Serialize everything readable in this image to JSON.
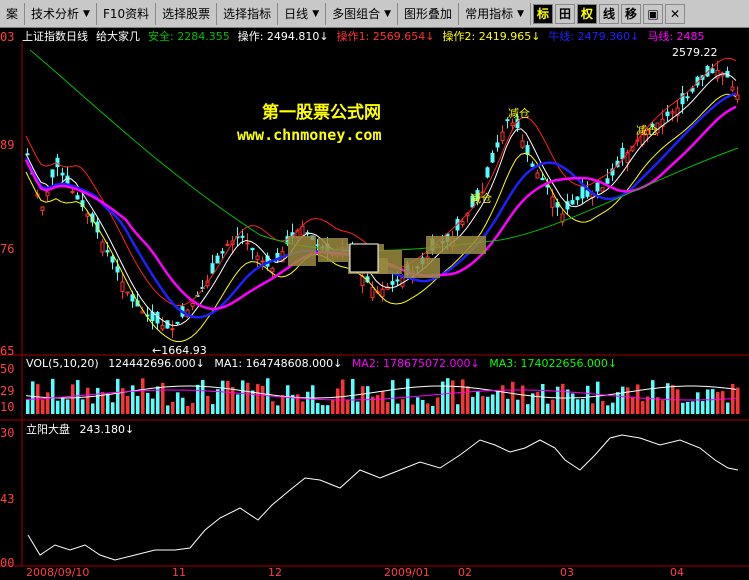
{
  "toolbar": {
    "items": [
      {
        "label": "案",
        "has_arrow": false
      },
      {
        "label": "技术分析",
        "has_arrow": true
      },
      {
        "label": "F10资料",
        "has_arrow": false
      },
      {
        "label": "选择股票",
        "has_arrow": false
      },
      {
        "label": "选择指标",
        "has_arrow": false
      },
      {
        "label": "日线",
        "has_arrow": true
      },
      {
        "label": "多图组合",
        "has_arrow": true
      },
      {
        "label": "图形叠加",
        "has_arrow": false
      },
      {
        "label": "常用指标",
        "has_arrow": true
      }
    ],
    "squares": [
      {
        "label": "标",
        "highlight": true
      },
      {
        "label": "田",
        "highlight": false
      },
      {
        "label": "权",
        "highlight": true
      },
      {
        "label": "线",
        "highlight": false
      },
      {
        "label": "移",
        "highlight": false
      },
      {
        "label": "▣",
        "highlight": false
      },
      {
        "label": "✕",
        "highlight": false
      }
    ]
  },
  "info": {
    "title": "上证指数日线",
    "indicator": "给大家几",
    "safe": "安全: 2284.355",
    "op": "操作: 2494.810↓",
    "op1": "操作1: 2569.654↓",
    "op2": "操作2: 2419.965↓",
    "cut1": "牛线: 2479.360↓",
    "cut2": "马线: 2485"
  },
  "price_axis": {
    "labels": [
      "03",
      "89",
      "76",
      "65"
    ]
  },
  "annotations": {
    "high": "2579.22",
    "low": "1664.93",
    "jian1": "减仓",
    "jian2": "减仓",
    "jian3": "减仓"
  },
  "watermark": {
    "line1": "第一股票公式网",
    "line2": "www.chnmoney.com"
  },
  "volume": {
    "header": "VOL(5,10,20)",
    "vol": "124442696.000↓",
    "ma1": "MA1: 164748608.000↓",
    "ma2": "MA2: 178675072.000↓",
    "ma3": "MA3: 174022656.000↓",
    "axis": [
      "50",
      "29",
      "10"
    ]
  },
  "indicator2": {
    "name": "立阳大盘",
    "value": "243.180↓",
    "axis": [
      "30",
      "43",
      "00"
    ]
  },
  "xaxis": {
    "labels": [
      "2008/09/10",
      "11",
      "12",
      "2009/01",
      "02",
      "03",
      "04"
    ]
  },
  "colors": {
    "up": "#ff3232",
    "down": "#54ffff",
    "ma_magenta": "#ff00ff",
    "ma_blue": "#2020ff",
    "ma_green": "#00c000",
    "text_yellow": "#ffff00"
  }
}
